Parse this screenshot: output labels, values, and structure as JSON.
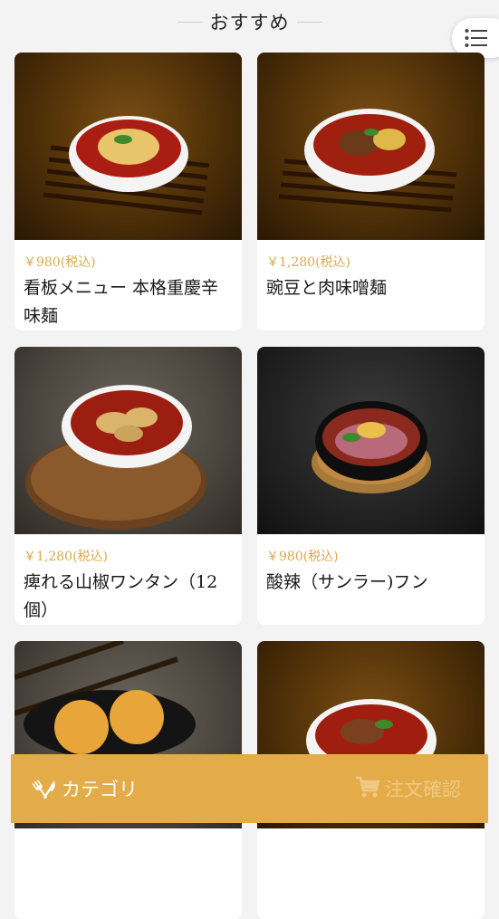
{
  "header": {
    "title": "おすすめ"
  },
  "menu": {
    "icon": "list-menu-icon"
  },
  "items": [
    {
      "price": "￥980(税込)",
      "name": "看板メニュー 本格重慶辛味麺"
    },
    {
      "price": "￥1,280(税込)",
      "name": "豌豆と肉味噌麺"
    },
    {
      "price": "￥1,280(税込)",
      "name": "痺れる山椒ワンタン（12個）"
    },
    {
      "price": "￥980(税込)",
      "name": "酸辣（サンラー)フン"
    }
  ],
  "bottom_bar": {
    "category_label": "カテゴリ",
    "category_icon": "fork-knife-icon",
    "order_label": "注文確認",
    "order_icon": "cart-icon"
  },
  "colors": {
    "accent": "#e3ac48",
    "price": "#d9a94e"
  }
}
